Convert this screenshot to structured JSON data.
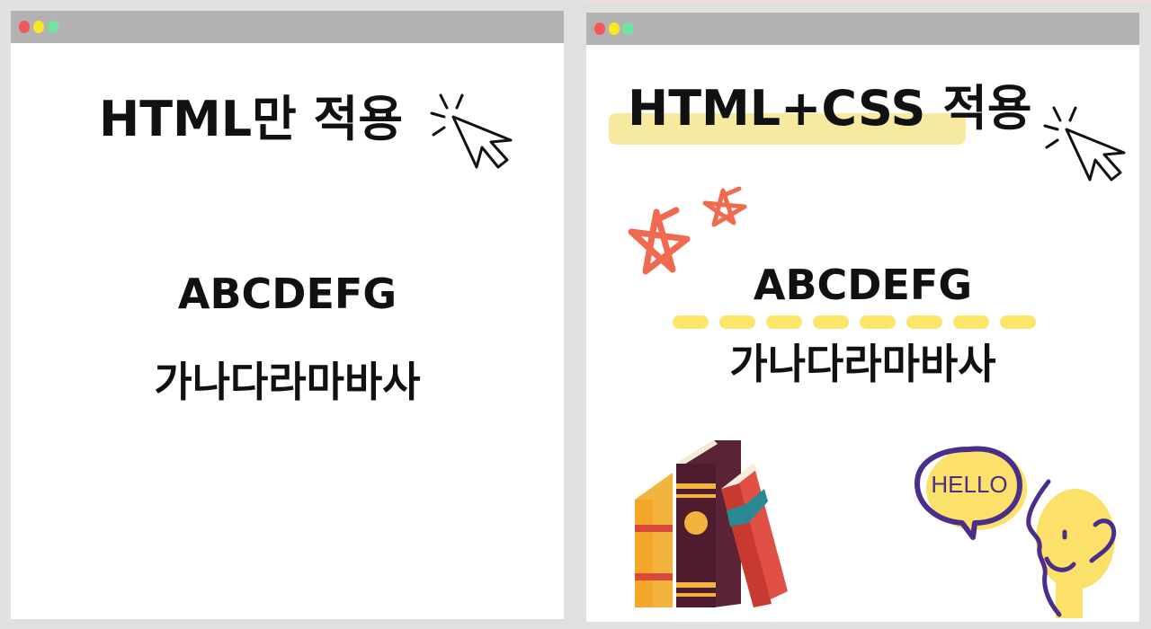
{
  "left_window": {
    "title": "HTML만 적용",
    "line1": "ABCDEFG",
    "line2": "가나다라마바사"
  },
  "right_window": {
    "title": "HTML+CSS 적용",
    "line1": "ABCDEFG",
    "line2": "가나다라마바사",
    "speech_bubble": "HELLO"
  },
  "colors": {
    "titlebar": "#b2b2b2",
    "dot_red": "#f5565c",
    "dot_yellow": "#f4eb26",
    "dot_green": "#6fe6a0",
    "highlight": "#f8e9a1",
    "dash_yellow": "#fbe56a",
    "star_red": "#ef6a4f",
    "bubble_purple": "#4a2f8a"
  },
  "icons": [
    "cursor-click-icon",
    "star-icon",
    "books-icon",
    "speech-bubble-icon",
    "person-face-icon"
  ]
}
